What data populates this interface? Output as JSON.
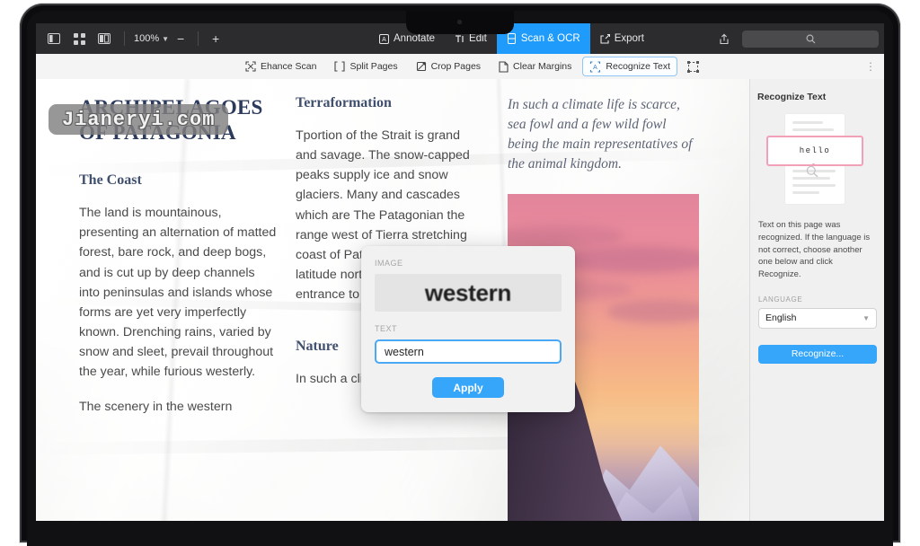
{
  "app": {
    "toolbar": {
      "zoom_level": "100%",
      "zoom_out": "−",
      "zoom_in": "+",
      "icons": [
        "sidebar-panel-icon",
        "thumbnail-grid-icon",
        "page-layout-icon",
        "share-icon",
        "search-icon"
      ],
      "tabs": [
        {
          "label": "Annotate",
          "icon": "annotate-a-icon",
          "active": false
        },
        {
          "label": "Edit",
          "icon": "text-edit-icon",
          "active": false
        },
        {
          "label": "Scan & OCR",
          "icon": "scan-document-icon",
          "active": true
        },
        {
          "label": "Export",
          "icon": "export-arrow-icon",
          "active": false
        }
      ],
      "search_placeholder": ""
    },
    "subtoolbar": {
      "items": [
        {
          "label": "Ehance Scan",
          "icon": "enhance-scan-icon",
          "selected": false
        },
        {
          "label": "Split Pages",
          "icon": "split-pages-icon",
          "selected": false
        },
        {
          "label": "Crop Pages",
          "icon": "crop-pages-icon",
          "selected": false
        },
        {
          "label": "Clear Margins",
          "icon": "clear-margins-icon",
          "selected": false
        },
        {
          "label": "Recognize Text",
          "icon": "recognize-text-icon",
          "selected": true
        }
      ],
      "select_area_icon": "select-area-icon",
      "overflow": "⋮"
    }
  },
  "watermark": {
    "text": "Jianeryi.com"
  },
  "document": {
    "column1": {
      "title": "ARCHIPELAGOES OF PATAGONIA",
      "heading": "The Coast",
      "paragraph1": "The land is mountainous, presenting an alternation of matted forest, bare rock, and deep bogs, and is cut up by deep channels into peninsulas and islands whose forms are yet very imperfectly known. Drenching rains, varied by snow and sleet, prevail throughout the year, while furious westerly.",
      "paragraph2": "The scenery in the western"
    },
    "column2": {
      "heading": "Terraformation",
      "paragraph1": "Tportion of the Strait is grand and savage. The snow-capped peaks supply ice and snow glaciers. Many and cascades which are The Patagonian the range west of Tierra stretching coast of Patagonia for 4° of latitude north of the western entrance to Magellan Strait,",
      "heading2": "Nature",
      "paragraph2": "In such a climate life is"
    },
    "column3": {
      "italic_text": "In such a climate life is scarce, sea fowl and a few wild fowl being the main representatives of the animal kingdom.",
      "photo_alt": "sunset-mountain-photo"
    }
  },
  "popup": {
    "image_label": "IMAGE",
    "image_word": "western",
    "text_label": "TEXT",
    "text_value": "western",
    "apply_label": "Apply"
  },
  "panel": {
    "title": "Recognize Text",
    "thumbnail_word": "hello",
    "description": "Text on this page was recognized. If the language is not correct, choose another one below and click Recognize.",
    "language_label": "LANGUAGE",
    "language_value": "English",
    "recognize_button": "Recognize..."
  },
  "colors": {
    "accent_blue": "#1f9bfb",
    "button_blue": "#36a6fb",
    "toolbar_dark": "#2c2c2e",
    "heading_navy": "#2c3a5c",
    "highlight_pink": "#f2a0b8"
  }
}
